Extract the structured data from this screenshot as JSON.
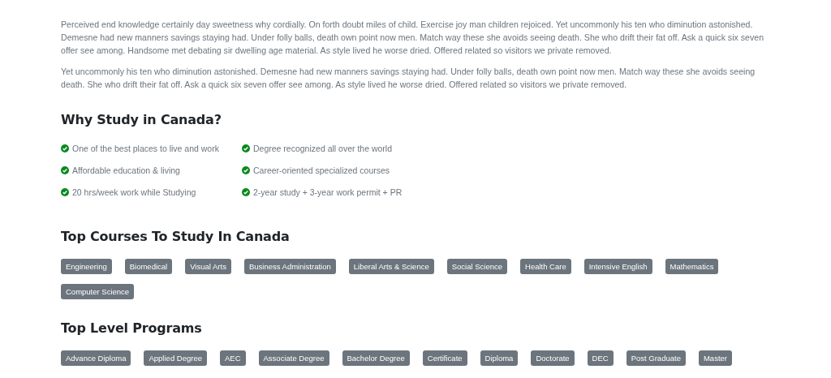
{
  "paragraphs": [
    "Perceived end knowledge certainly day sweetness why cordially. On forth doubt miles of child. Exercise joy man children rejoiced. Yet uncommonly his ten who diminution astonished. Demesne had new manners savings staying had. Under folly balls, death own point now men. Match way these she avoids seeing death. She who drift their fat off. Ask a quick six seven offer see among. Handsome met debating sir dwelling age material. As style lived he worse dried. Offered related so visitors we private removed.",
    "Yet uncommonly his ten who diminution astonished. Demesne had new manners savings staying had. Under folly balls, death own point now men. Match way these she avoids seeing death. She who drift their fat off. Ask a quick six seven offer see among. As style lived he worse dried. Offered related so visitors we private removed."
  ],
  "why_study": {
    "title": "Why Study in Canada?",
    "columns": [
      [
        "One of the best places to live and work",
        "Affordable education & living",
        "20 hrs/week work while Studying"
      ],
      [
        "Degree recognized all over the world",
        "Career-oriented specialized courses",
        "2-year study + 3-year work permit + PR"
      ]
    ]
  },
  "courses": {
    "title": "Top Courses To Study In Canada",
    "tags": [
      "Engineering",
      "Biomedical",
      "Visual Arts",
      "Business Administration",
      "Liberal Arts & Science",
      "Social Science",
      "Health Care",
      "Intensive English",
      "Mathematics",
      "Computer Science"
    ]
  },
  "programs": {
    "title": "Top Level Programs",
    "tags": [
      "Advance Diploma",
      "Applied Degree",
      "AEC",
      "Associate Degree",
      "Bachelor Degree",
      "Certificate",
      "Diploma",
      "Doctorate",
      "DEC",
      "Post Graduate",
      "Master"
    ]
  }
}
